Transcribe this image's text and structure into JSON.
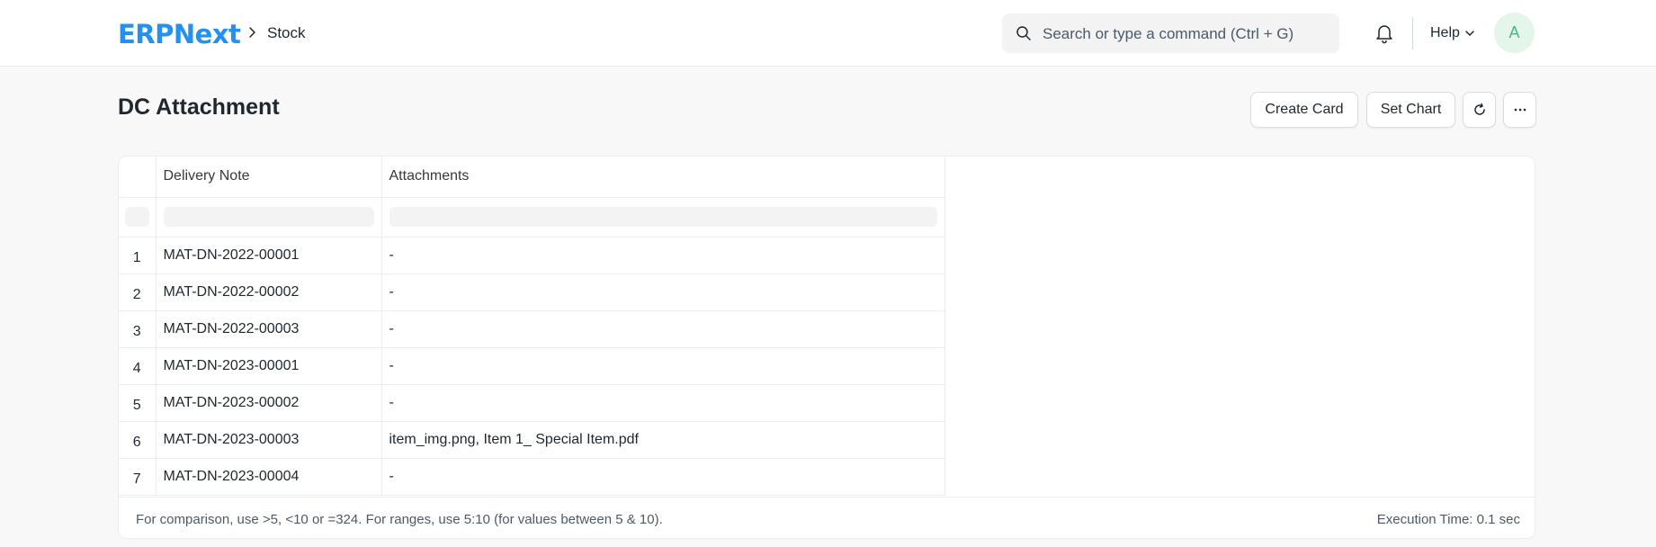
{
  "navbar": {
    "logo": "ERPNext",
    "breadcrumb": "Stock",
    "search_placeholder": "Search or type a command (Ctrl + G)",
    "help_label": "Help",
    "avatar_initial": "A"
  },
  "page": {
    "title": "DC Attachment",
    "actions": {
      "create_card": "Create Card",
      "set_chart": "Set Chart"
    }
  },
  "report": {
    "columns": [
      "Delivery Note",
      "Attachments"
    ],
    "rows": [
      {
        "index": "1",
        "delivery_note": "MAT-DN-2022-00001",
        "attachments": "-"
      },
      {
        "index": "2",
        "delivery_note": "MAT-DN-2022-00002",
        "attachments": "-"
      },
      {
        "index": "3",
        "delivery_note": "MAT-DN-2022-00003",
        "attachments": "-"
      },
      {
        "index": "4",
        "delivery_note": "MAT-DN-2023-00001",
        "attachments": "-"
      },
      {
        "index": "5",
        "delivery_note": "MAT-DN-2023-00002",
        "attachments": "-"
      },
      {
        "index": "6",
        "delivery_note": "MAT-DN-2023-00003",
        "attachments": "item_img.png, Item 1_ Special Item.pdf"
      },
      {
        "index": "7",
        "delivery_note": "MAT-DN-2023-00004",
        "attachments": "-"
      }
    ],
    "footer_hint": "For comparison, use >5, <10 or =324. For ranges, use 5:10 (for values between 5 & 10).",
    "execution_time": "Execution Time: 0.1 sec"
  },
  "colors": {
    "brand": "#2490ef",
    "avatar_bg": "#e4f5e9",
    "avatar_fg": "#48bb74"
  },
  "icons": [
    "search-icon",
    "bell-icon",
    "chevron-right-icon",
    "chevron-down-icon",
    "refresh-icon",
    "more-icon"
  ]
}
